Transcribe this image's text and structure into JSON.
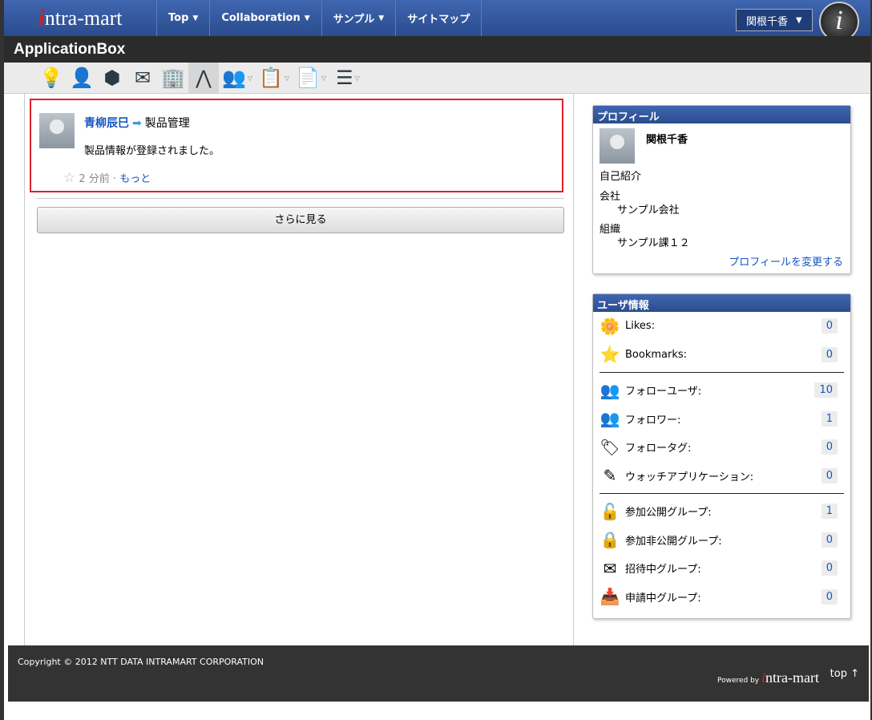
{
  "header": {
    "logo": "intra-mart",
    "nav": [
      {
        "label": "Top"
      },
      {
        "label": "Collaboration"
      },
      {
        "label": "サンプル"
      },
      {
        "label": "サイトマップ"
      }
    ],
    "user": "関根千香",
    "caret": "▼"
  },
  "title": "ApplicationBox",
  "toolbar": [
    {
      "icon": "lightbulb-icon",
      "glyph": "💡"
    },
    {
      "icon": "user-icon",
      "glyph": "👤"
    },
    {
      "icon": "cube-icon",
      "glyph": "⬢"
    },
    {
      "icon": "mail-icon",
      "glyph": "✉"
    },
    {
      "icon": "building-icon",
      "glyph": "🏢"
    },
    {
      "icon": "watch-app-icon",
      "glyph": "⋀"
    },
    {
      "icon": "group-icon",
      "glyph": "👥"
    },
    {
      "icon": "clipboard-user-icon",
      "glyph": "📋"
    },
    {
      "icon": "document-pin-icon",
      "glyph": "📄"
    },
    {
      "icon": "list-icon",
      "glyph": "☰"
    }
  ],
  "post": {
    "author": "青柳辰巳",
    "arrow": "➡",
    "target": "製品管理",
    "message": "製品情報が登録されました。",
    "star": "☆",
    "time": "2 分前 ·",
    "more": "もっと"
  },
  "see_more": "さらに見る",
  "profile": {
    "title": "プロフィール",
    "name": "関根千香",
    "intro_label": "自己紹介",
    "company_label": "会社",
    "company": "サンプル会社",
    "org_label": "組織",
    "org": "サンプル課１２",
    "edit_link": "プロフィールを変更する"
  },
  "user_info": {
    "title": "ユーザ情報",
    "groups": [
      [
        {
          "label": "Likes:",
          "count": "0",
          "glyph": "🌼",
          "icon": "likes-icon"
        },
        {
          "label": "Bookmarks:",
          "count": "0",
          "glyph": "⭐",
          "icon": "star-icon"
        }
      ],
      [
        {
          "label": "フォローユーザ:",
          "count": "10",
          "glyph": "👥",
          "icon": "follow-user-icon"
        },
        {
          "label": "フォロワー:",
          "count": "1",
          "glyph": "👥",
          "icon": "follower-icon"
        },
        {
          "label": "フォロータグ:",
          "count": "0",
          "glyph": "🏷",
          "icon": "tag-icon"
        },
        {
          "label": "ウォッチアプリケーション:",
          "count": "0",
          "glyph": "✎",
          "icon": "watch-app-icon"
        }
      ],
      [
        {
          "label": "参加公開グループ:",
          "count": "1",
          "glyph": "🔓",
          "icon": "unlock-icon"
        },
        {
          "label": "参加非公開グループ:",
          "count": "0",
          "glyph": "🔒",
          "icon": "lock-icon"
        },
        {
          "label": "招待中グループ:",
          "count": "0",
          "glyph": "✉",
          "icon": "invite-mail-icon"
        },
        {
          "label": "申請中グループ:",
          "count": "0",
          "glyph": "📥",
          "icon": "inbox-icon"
        }
      ]
    ]
  },
  "footer": {
    "copyright": "Copyright © 2012 NTT DATA INTRAMART CORPORATION",
    "powered": "Powered by",
    "logo": "intra-mart",
    "top": "top ↑"
  }
}
